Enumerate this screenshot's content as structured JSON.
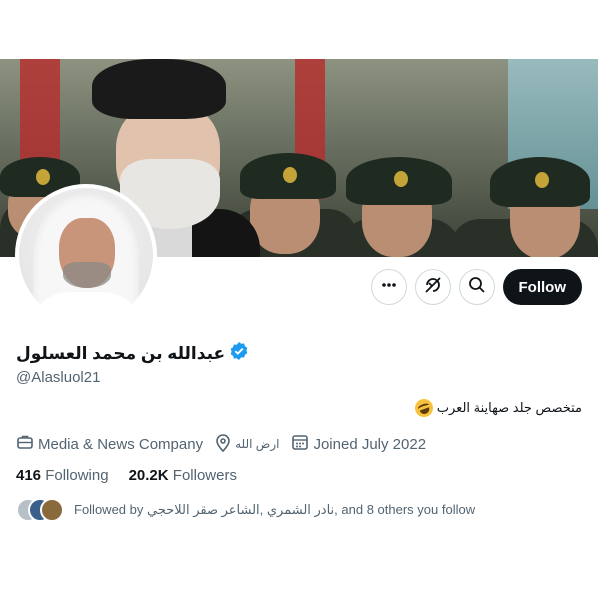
{
  "profile": {
    "display_name": "عبدالله بن محمد العسلول",
    "verified": true,
    "handle": "@Alasluol21",
    "bio": "متخصص جلد صهاينة العرب",
    "bio_emoji": "rolling-on-floor-laughing"
  },
  "actions": {
    "more_icon": "more-horizontal-icon",
    "unsubscribe_icon": "subscribe-slashed-icon",
    "search_icon": "search-icon",
    "follow_label": "Follow"
  },
  "meta": {
    "category": "Media & News Company",
    "location": "ارض الله",
    "joined": "Joined July 2022"
  },
  "stats": {
    "following_count": "416",
    "following_label": "Following",
    "followers_count": "20.2K",
    "followers_label": "Followers"
  },
  "followed_by": {
    "text": "Followed by نادر الشمري ,الشاعر صقر اللاحجي, and 8 others you follow"
  },
  "colors": {
    "verified_badge": "#1d9bf0",
    "follow_bg": "#0f1419",
    "secondary_text": "#536471"
  }
}
